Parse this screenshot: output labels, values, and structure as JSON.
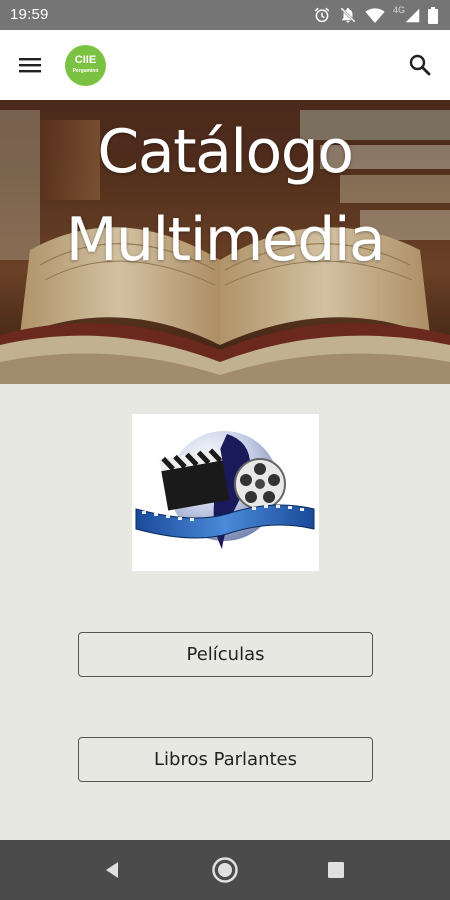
{
  "status_bar": {
    "time": "19:59",
    "network_type": "4G",
    "icons": [
      "alarm-icon",
      "notifications-off-icon",
      "wifi-icon",
      "cell-signal-icon",
      "battery-icon"
    ]
  },
  "app_bar": {
    "menu_icon": "menu-icon",
    "logo": {
      "main_text": "CIIE",
      "sub_text": "Pergamino",
      "color": "#7cc242"
    },
    "search_icon": "search-icon"
  },
  "hero": {
    "title_line1": "Catálogo",
    "title_line2": "Multimedia"
  },
  "main": {
    "image": "film-reel-clapperboard-image",
    "buttons": [
      {
        "label": "Películas"
      },
      {
        "label": "Libros Parlantes"
      }
    ]
  },
  "nav_bar": {
    "icons": [
      "back-icon",
      "home-icon",
      "recents-icon"
    ]
  },
  "colors": {
    "status_bar": "#757575",
    "app_bar": "#ffffff",
    "background": "#e8e8e3",
    "nav_bar": "#4b4b4b",
    "logo_green": "#7cc242"
  }
}
